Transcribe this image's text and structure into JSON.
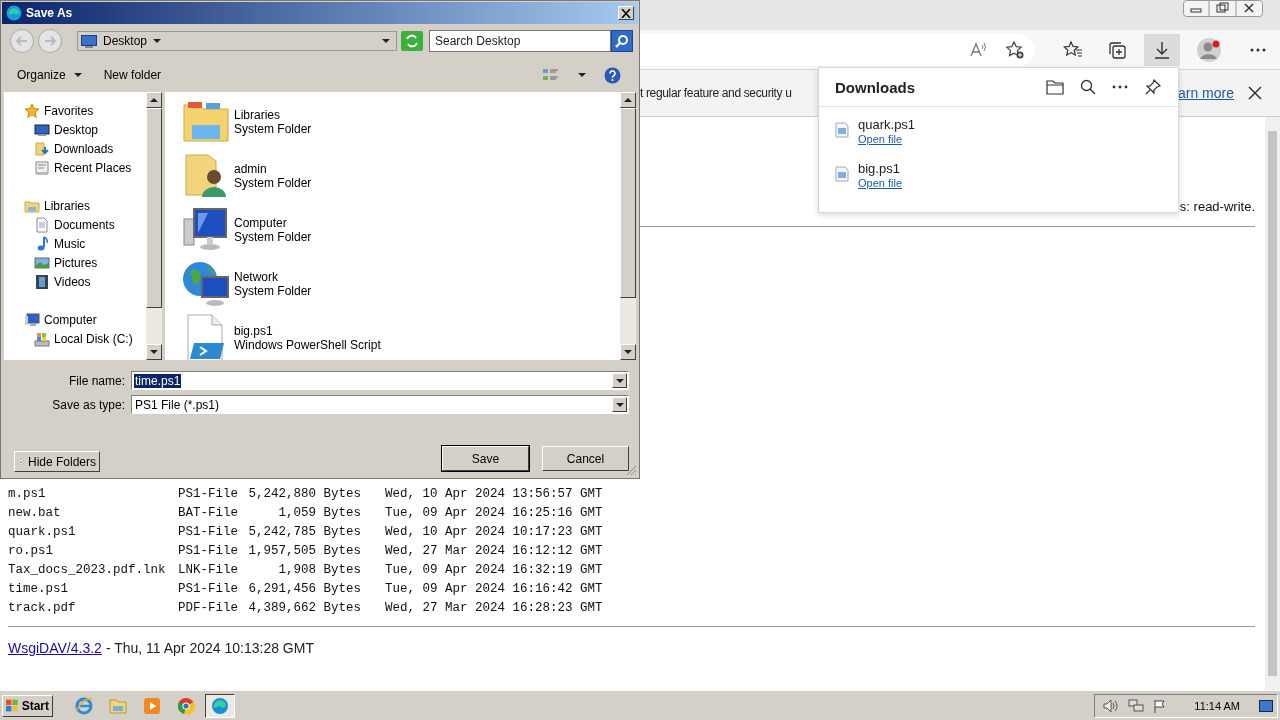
{
  "browser": {
    "info_bar": {
      "text": "t regular feature and security u",
      "link": "arn more"
    },
    "page": {
      "permissions_text": "s: read-write.",
      "files": [
        {
          "name": "m.ps1",
          "type": "PS1-File",
          "size": "5,242,880 Bytes",
          "date": "Wed, 10 Apr 2024 13:56:57 GMT"
        },
        {
          "name": "new.bat",
          "type": "BAT-File",
          "size": "1,059 Bytes",
          "date": "Tue, 09 Apr 2024 16:25:16 GMT"
        },
        {
          "name": "quark.ps1",
          "type": "PS1-File",
          "size": "5,242,785 Bytes",
          "date": "Wed, 10 Apr 2024 10:17:23 GMT"
        },
        {
          "name": "ro.ps1",
          "type": "PS1-File",
          "size": "1,957,505 Bytes",
          "date": "Wed, 27 Mar 2024 16:12:12 GMT"
        },
        {
          "name": "Tax_docs_2023.pdf.lnk",
          "type": "LNK-File",
          "size": "1,908 Bytes",
          "date": "Tue, 09 Apr 2024 16:32:19 GMT"
        },
        {
          "name": "time.ps1",
          "type": "PS1-File",
          "size": "6,291,456 Bytes",
          "date": "Tue, 09 Apr 2024 16:16:42 GMT"
        },
        {
          "name": "track.pdf",
          "type": "PDF-File",
          "size": "4,389,662 Bytes",
          "date": "Wed, 27 Mar 2024 16:28:23 GMT"
        }
      ],
      "footer": {
        "link": "WsgiDAV/4.3.2",
        "text": "- Thu, 11 Apr 2024 10:13:28 GMT"
      }
    }
  },
  "downloads": {
    "title": "Downloads",
    "items": [
      {
        "name": "quark.ps1",
        "action": "Open file"
      },
      {
        "name": "big.ps1",
        "action": "Open file"
      }
    ]
  },
  "dialog": {
    "title": "Save As",
    "location": "Desktop",
    "search": {
      "placeholder": "Search Desktop"
    },
    "toolbar": [
      "Organize",
      "New folder"
    ],
    "nav": [
      {
        "label": "Favorites",
        "kind": "star",
        "children": [
          {
            "label": "Desktop",
            "kind": "desktop"
          },
          {
            "label": "Downloads",
            "kind": "downloads"
          },
          {
            "label": "Recent Places",
            "kind": "recent"
          }
        ]
      },
      {
        "label": "Libraries",
        "kind": "libraries",
        "children": [
          {
            "label": "Documents",
            "kind": "document"
          },
          {
            "label": "Music",
            "kind": "music"
          },
          {
            "label": "Pictures",
            "kind": "pictures"
          },
          {
            "label": "Videos",
            "kind": "videos"
          }
        ]
      },
      {
        "label": "Computer",
        "kind": "computer",
        "children": [
          {
            "label": "Local Disk (C:)",
            "kind": "disk"
          }
        ]
      }
    ],
    "items": [
      {
        "name": "Libraries",
        "type": "System Folder",
        "kind": "libraries"
      },
      {
        "name": "admin",
        "type": "System Folder",
        "kind": "user"
      },
      {
        "name": "Computer",
        "type": "System Folder",
        "kind": "computer"
      },
      {
        "name": "Network",
        "type": "System Folder",
        "kind": "network"
      },
      {
        "name": "big.ps1",
        "type": "Windows PowerShell Script",
        "kind": "script"
      }
    ],
    "file_name": {
      "label": "File name:",
      "value": "time.ps1",
      "selected": true
    },
    "save_as_type": {
      "label": "Save as type:",
      "value": "PS1 File (*.ps1)"
    },
    "hide_folders": "Hide Folders",
    "buttons": [
      "Save",
      "Cancel"
    ]
  },
  "taskbar": {
    "start": "Start",
    "apps": [
      {
        "kind": "ie",
        "selected": false
      },
      {
        "kind": "explorer",
        "selected": false
      },
      {
        "kind": "media",
        "selected": false
      },
      {
        "kind": "chrome",
        "selected": false
      },
      {
        "kind": "edge",
        "selected": true
      }
    ],
    "clock": "11:14 AM"
  }
}
